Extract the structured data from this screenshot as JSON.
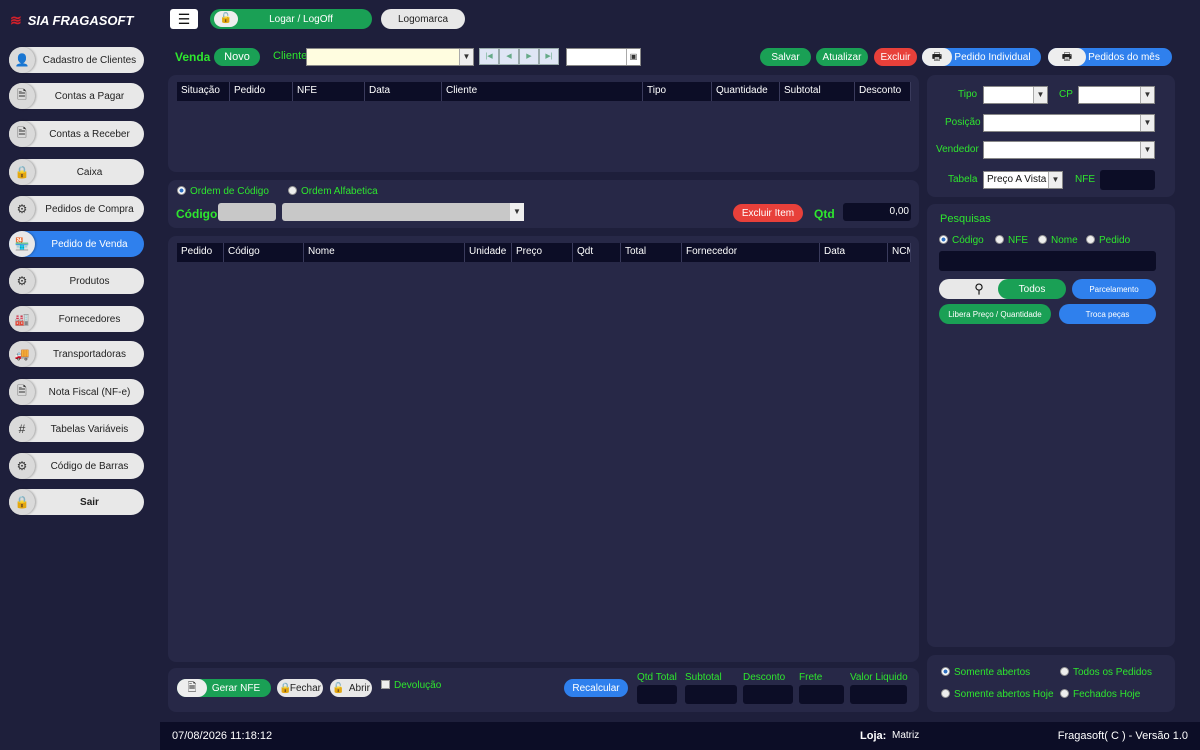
{
  "brand": {
    "logo_text": "SIA FRAGASOFT"
  },
  "topbar": {
    "menu_icon": "hamburger-icon",
    "login_label": "Logar / LogOff",
    "logo_label": "Logomarca"
  },
  "sidebar": {
    "items": [
      {
        "label": "Cadastro de Clientes",
        "icon": "user-icon",
        "glyph": "👤"
      },
      {
        "label": "Contas a Pagar",
        "icon": "document-icon",
        "glyph": "🗎"
      },
      {
        "label": "Contas a Receber",
        "icon": "document-icon",
        "glyph": "🗎"
      },
      {
        "label": "Caixa",
        "icon": "lock-icon",
        "glyph": "🔒"
      },
      {
        "label": "Pedidos de Compra",
        "icon": "gears-icon",
        "glyph": "⚙"
      },
      {
        "label": "Pedido de Venda",
        "icon": "store-icon",
        "glyph": "🏪"
      },
      {
        "label": "Produtos",
        "icon": "gears-icon",
        "glyph": "⚙"
      },
      {
        "label": "Fornecedores",
        "icon": "factory-icon",
        "glyph": "🏭"
      },
      {
        "label": "Transportadoras",
        "icon": "truck-icon",
        "glyph": "🚚"
      },
      {
        "label": "Nota Fiscal (NF-e)",
        "icon": "document-icon",
        "glyph": "🗎"
      },
      {
        "label": "Tabelas Variáveis",
        "icon": "hash-icon",
        "glyph": "#"
      },
      {
        "label": "Código de Barras",
        "icon": "gears-icon",
        "glyph": "⚙"
      },
      {
        "label": "Sair",
        "icon": "lock-icon",
        "glyph": "🔒"
      }
    ]
  },
  "venda": {
    "title": "Venda",
    "novo": "Novo",
    "cliente_label": "Cliente",
    "salvar": "Salvar",
    "atualizar": "Atualizar",
    "excluir": "Excluir",
    "pedido_individual": "Pedido Individual",
    "pedidos_mes": "Pedidos do mês"
  },
  "orders_table": {
    "columns": [
      "Situação",
      "Pedido",
      "NFE",
      "Data",
      "Cliente",
      "Tipo",
      "Quantidade",
      "Subtotal",
      "Desconto"
    ]
  },
  "filters": {
    "tipo": "Tipo",
    "cp": "CP",
    "posicao": "Posição",
    "vendedor": "Vendedor",
    "tabela": "Tabela",
    "tabela_value": "Preço A Vista",
    "nfe": "NFE"
  },
  "item_entry": {
    "ordem_codigo": "Ordem de Código",
    "ordem_alfabetica": "Ordem Alfabetica",
    "codigo": "Código",
    "excluir_item": "Excluir Item",
    "qtd": "Qtd",
    "qtd_value": "0,00"
  },
  "items_table": {
    "columns": [
      "Pedido",
      "Código",
      "Nome",
      "Unidade",
      "Preço",
      "Qdt",
      "Total",
      "Fornecedor",
      "Data",
      "NCM"
    ]
  },
  "pesquisas": {
    "title": "Pesquisas",
    "codigo": "Código",
    "nfe": "NFE",
    "nome": "Nome",
    "pedido": "Pedido",
    "todos": "Todos",
    "parcelamento": "Parcelamento",
    "libera": "Libera Preço / Quantidade",
    "troca": "Troca peças"
  },
  "status_filters": {
    "somente_abertos": "Somente abertos",
    "todos_pedidos": "Todos os Pedidos",
    "somente_abertos_hoje": "Somente abertos Hoje",
    "fechados_hoje": "Fechados Hoje"
  },
  "footer_bar": {
    "gerar_nfe": "Gerar NFE",
    "fechar": "Fechar",
    "abrir": "Abrir",
    "devolucao": "Devolução",
    "recalcular": "Recalcular",
    "qtd_total": "Qtd Total",
    "subtotal": "Subtotal",
    "desconto": "Desconto",
    "frete": "Frete",
    "valor_liquido": "Valor Liquido"
  },
  "status_bar": {
    "datetime": "07/08/2026 11:18:12",
    "loja_label": "Loja:",
    "loja_value": "Matriz",
    "version": "Fragasoft( C ) - Versão 1.0"
  },
  "colors": {
    "background": "#1e1f3b",
    "panel": "#272847",
    "accent_green": "#1aa055",
    "accent_red": "#e8403a",
    "accent_blue": "#2f80ed",
    "label_green": "#2ee62e"
  }
}
